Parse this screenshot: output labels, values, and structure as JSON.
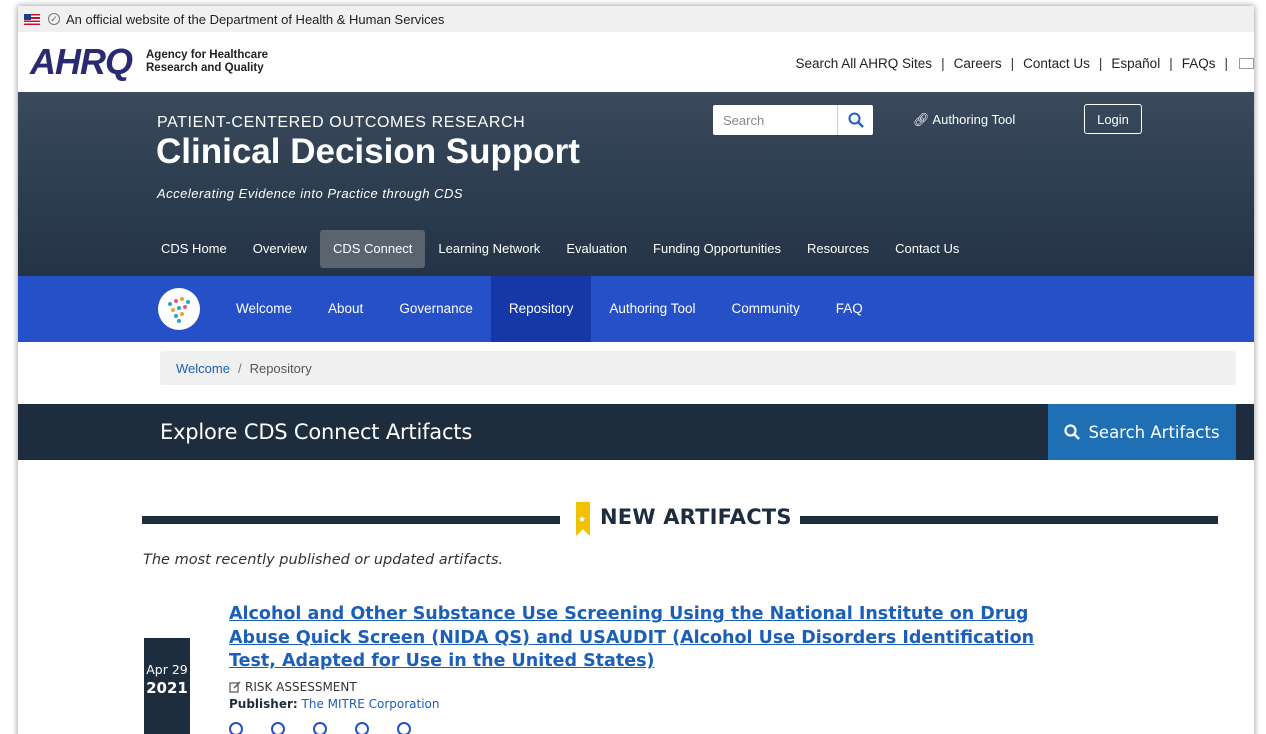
{
  "gov_banner": {
    "text": "An official website of the Department of Health & Human Services"
  },
  "ahrq": {
    "logo_text": "AHRQ",
    "name_line1": "Agency for Healthcare",
    "name_line2": "Research and Quality",
    "util_links": [
      "Search All AHRQ Sites",
      "Careers",
      "Contact Us",
      "Español",
      "FAQs"
    ]
  },
  "hero": {
    "kicker": "PATIENT-CENTERED OUTCOMES RESEARCH",
    "title": "Clinical Decision Support",
    "subtitle": "Accelerating Evidence into Practice through CDS",
    "search_placeholder": "Search",
    "authoring_link": "Authoring Tool",
    "login_label": "Login",
    "nav": [
      "CDS Home",
      "Overview",
      "CDS Connect",
      "Learning Network",
      "Evaluation",
      "Funding Opportunities",
      "Resources",
      "Contact Us"
    ],
    "nav_active": "CDS Connect"
  },
  "sub_nav": {
    "items": [
      "Welcome",
      "About",
      "Governance",
      "Repository",
      "Authoring Tool",
      "Community",
      "FAQ"
    ],
    "active": "Repository"
  },
  "breadcrumb": {
    "home": "Welcome",
    "separator": "/",
    "current": "Repository"
  },
  "explore": {
    "title": "Explore CDS Connect Artifacts",
    "search_button": "Search Artifacts"
  },
  "new_artifacts": {
    "heading": "NEW ARTIFACTS",
    "description": "The most recently published or updated artifacts."
  },
  "artifact": {
    "date_md": "Apr 29",
    "date_year": "2021",
    "title": "Alcohol and Other Substance Use Screening Using the National Institute on Drug Abuse Quick Screen (NIDA QS) and USAUDIT (Alcohol Use Disorders Identification Test, Adapted for Use in the United States)",
    "type": "RISK ASSESSMENT",
    "publisher_label": "Publisher:",
    "publisher": "The MITRE Corporation"
  },
  "colors": {
    "hero_bg": "#2c3c4f",
    "subnav_bg": "#2550c8",
    "subnav_active": "#1637a8",
    "explore_bg": "#1e2d3d",
    "search_artifacts_bg": "#1f6fb5",
    "link": "#1b5fb8",
    "ribbon_yellow": "#f2c200"
  }
}
